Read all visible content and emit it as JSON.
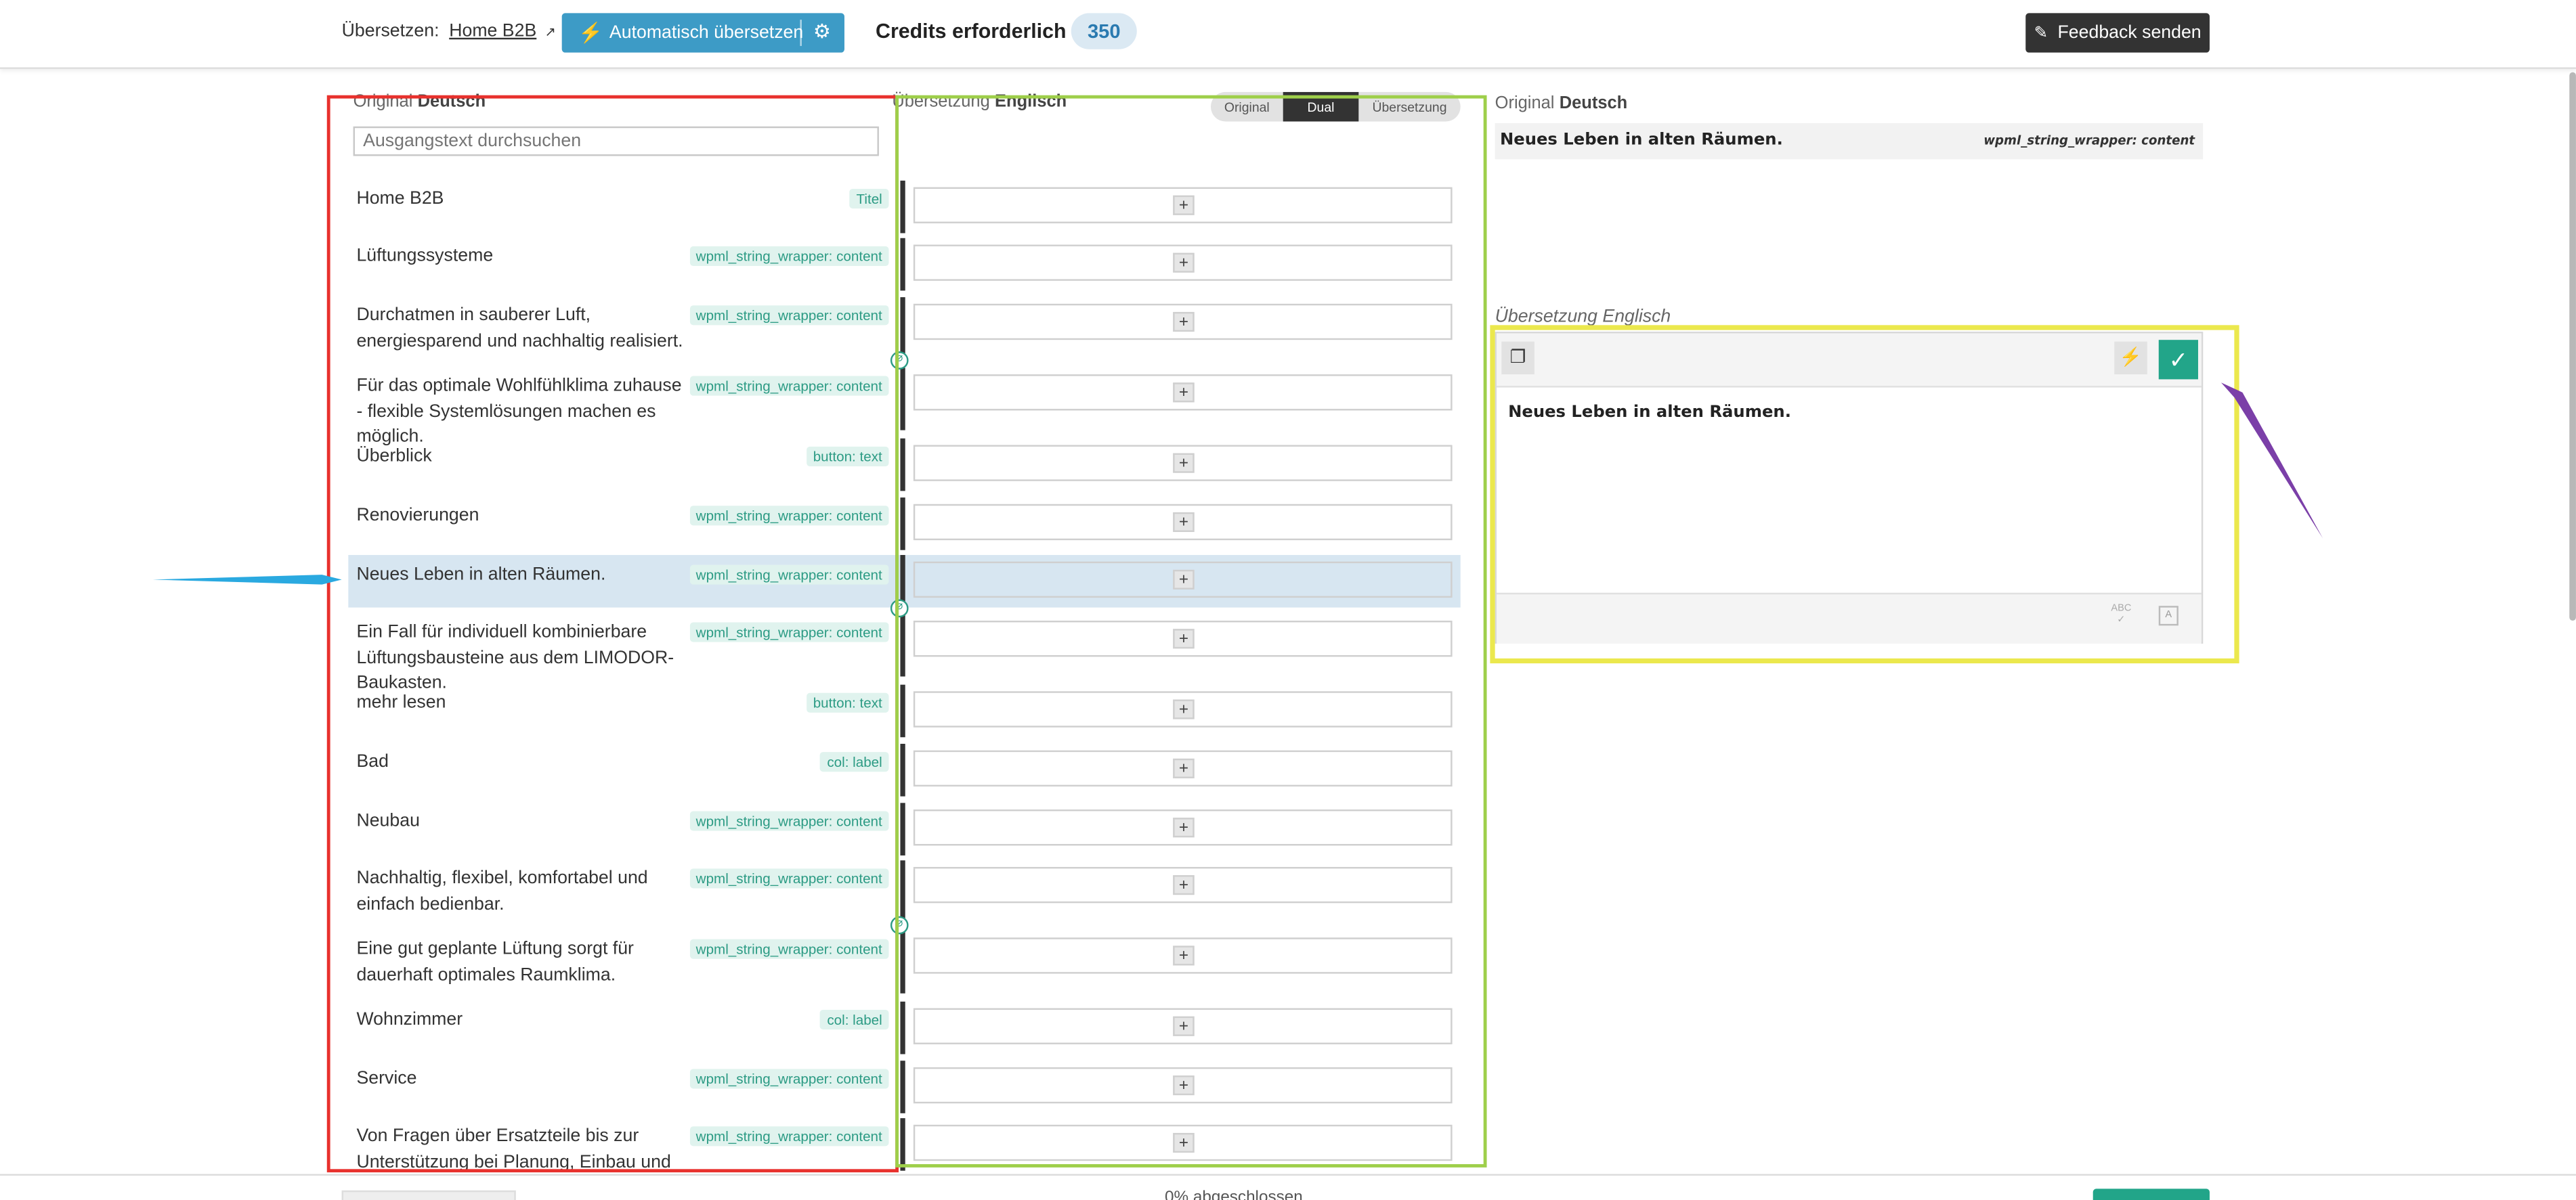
{
  "header": {
    "translate_label": "Übersetzen:",
    "translate_link": "Home B2B",
    "auto_translate_label": "Automatisch übersetzen",
    "credits_label": "Credits erforderlich",
    "credits_value": "350",
    "feedback_label": "Feedback senden"
  },
  "original_column": {
    "label": "Original",
    "language": "Deutsch",
    "search_placeholder": "Ausgangstext durchsuchen"
  },
  "translation_column": {
    "label": "Übersetzung",
    "language": "Englisch",
    "modes": [
      "Original",
      "Dual",
      "Übersetzung"
    ],
    "active_mode": "Dual"
  },
  "rows": [
    {
      "text": "Home B2B",
      "tag": "Titel"
    },
    {
      "text": "Lüftungssysteme",
      "tag": "wpml_string_wrapper: content"
    },
    {
      "text": "Durchatmen in sauberer Luft, energiesparend und nachhaltig realisiert.",
      "tag": "wpml_string_wrapper: content"
    },
    {
      "text": "Für das optimale Wohlfühlklima zuhause - flexible Systemlösungen machen es möglich.",
      "tag": "wpml_string_wrapper: content"
    },
    {
      "text": "Überblick",
      "tag": "button: text"
    },
    {
      "text": "Renovierungen",
      "tag": "wpml_string_wrapper: content"
    },
    {
      "text": "Neues Leben in alten Räumen.",
      "tag": "wpml_string_wrapper: content"
    },
    {
      "text": "Ein Fall für individuell kombinierbare Lüftungsbausteine aus dem LIMODOR- Baukasten.",
      "tag": "wpml_string_wrapper: content"
    },
    {
      "text": "mehr lesen",
      "tag": "button: text"
    },
    {
      "text": "Bad",
      "tag": "col: label"
    },
    {
      "text": "Neubau",
      "tag": "wpml_string_wrapper: content"
    },
    {
      "text": "Nachhaltig, flexibel, komfortabel und einfach bedienbar.",
      "tag": "wpml_string_wrapper: content"
    },
    {
      "text": "Eine gut geplante Lüftung sorgt für dauerhaft optimales Raumklima.",
      "tag": "wpml_string_wrapper: content"
    },
    {
      "text": "Wohnzimmer",
      "tag": "col: label"
    },
    {
      "text": "Service",
      "tag": "wpml_string_wrapper: content"
    },
    {
      "text": "Von Fragen über Ersatzteile bis zur Unterstützung bei Planung, Einbau und Betrieb - wir helfen",
      "tag": "wpml_string_wrapper: content"
    }
  ],
  "plus_label": "+",
  "editor": {
    "original_label": "Original",
    "original_language": "Deutsch",
    "original_text": "Neues Leben in alten Räumen.",
    "original_tag": "wpml_string_wrapper: content",
    "translation_label": "Übersetzung",
    "translation_language": "Englisch",
    "translation_text": "Neues Leben in alten Räumen.",
    "spell_label": "ABC",
    "font_label": "A"
  },
  "footer": {
    "progress_text": "0% abgeschlossen"
  },
  "icons": {
    "external_link": "external-link-icon",
    "bolt": "bolt-icon",
    "gear": "gear-icon",
    "pen": "pen-icon",
    "copy": "copy-icon",
    "check": "check-icon",
    "spellcheck": "spellcheck-icon",
    "font": "font-icon",
    "link": "link-icon"
  },
  "colors": {
    "primary_blue": "#3d9bc6",
    "confirm_green": "#22a589",
    "tag_green": "#2c9b84",
    "highlight_red": "#e8312d",
    "highlight_green": "#9ecf4a",
    "highlight_yellow": "#ebe84d",
    "arrow_blue": "#2aa9e0",
    "arrow_purple": "#7b3fa8"
  }
}
